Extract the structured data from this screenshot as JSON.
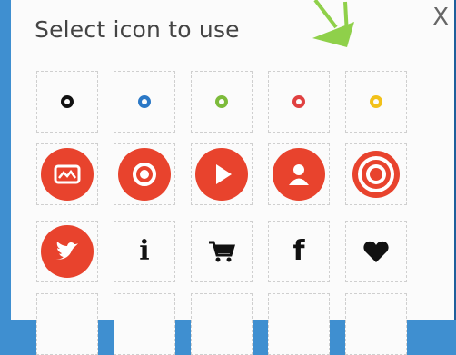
{
  "dialog": {
    "title": "Select icon to use",
    "close_label": "X"
  },
  "colors": {
    "accent_red": "#e8432d",
    "ring_black": "#111111",
    "ring_blue": "#2b78c6",
    "ring_green": "#7dbb3b",
    "ring_red": "#e04040",
    "ring_yellow": "#f2c11a",
    "arrow_green": "#8fd04a"
  },
  "icons": [
    {
      "name": "circle-black-icon"
    },
    {
      "name": "circle-blue-icon"
    },
    {
      "name": "circle-green-icon"
    },
    {
      "name": "circle-red-icon"
    },
    {
      "name": "circle-yellow-icon"
    },
    {
      "name": "picture-icon"
    },
    {
      "name": "record-icon"
    },
    {
      "name": "play-icon"
    },
    {
      "name": "user-icon"
    },
    {
      "name": "target-icon"
    },
    {
      "name": "twitter-icon"
    },
    {
      "name": "info-icon",
      "glyph": "i"
    },
    {
      "name": "cart-icon"
    },
    {
      "name": "facebook-icon",
      "glyph": "f"
    },
    {
      "name": "heart-icon"
    }
  ]
}
